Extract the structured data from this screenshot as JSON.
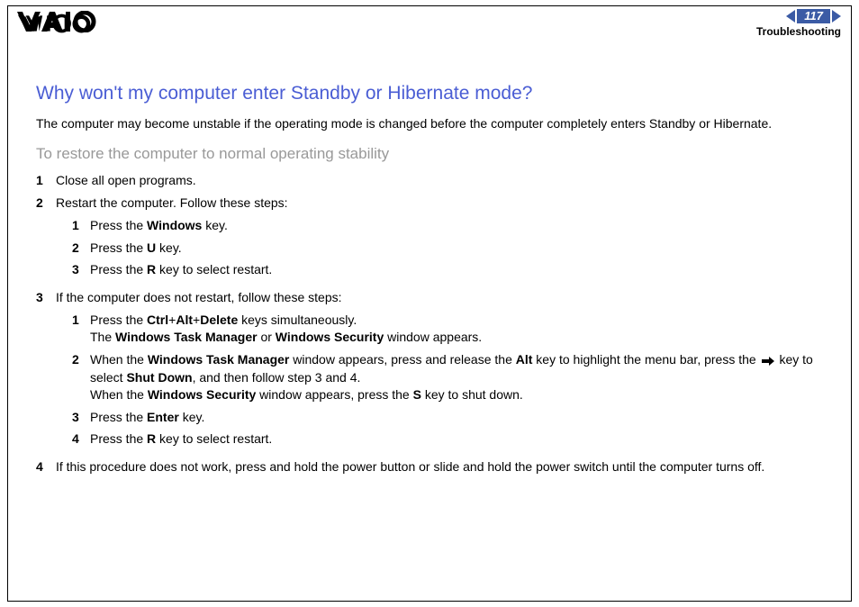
{
  "header": {
    "page_number": "117",
    "section": "Troubleshooting"
  },
  "title": "Why won't my computer enter Standby or Hibernate mode?",
  "intro": "The computer may become unstable if the operating mode is changed before the computer completely enters Standby or Hibernate.",
  "subtitle": "To restore the computer to normal operating stability",
  "steps": {
    "s1": {
      "num": "1",
      "text": "Close all open programs."
    },
    "s2": {
      "num": "2",
      "text": "Restart the computer. Follow these steps:",
      "sub": {
        "a": {
          "num": "1",
          "prefix": "Press the ",
          "key": "Windows",
          "suffix": " key."
        },
        "b": {
          "num": "2",
          "prefix": "Press the ",
          "key": "U",
          "suffix": " key."
        },
        "c": {
          "num": "3",
          "prefix": "Press the ",
          "key": "R",
          "suffix": " key to select restart."
        }
      }
    },
    "s3": {
      "num": "3",
      "text": "If the computer does not restart, follow these steps:",
      "sub": {
        "a": {
          "num": "1",
          "line1_prefix": "Press the ",
          "k1": "Ctrl",
          "plus1": "+",
          "k2": "Alt",
          "plus2": "+",
          "k3": "Delete",
          "line1_suffix": " keys simultaneously.",
          "line2_prefix": "The ",
          "wtm": "Windows Task Manager",
          "or": " or ",
          "ws": "Windows Security",
          "line2_suffix": " window appears."
        },
        "b": {
          "num": "2",
          "p1": "When the ",
          "wtm": "Windows Task Manager",
          "p2": " window appears, press and release the ",
          "alt": "Alt",
          "p3": " key to highlight the menu bar, press the ",
          "p4": " key to select ",
          "sd": "Shut Down",
          "p5": ", and then follow step 3 and 4.",
          "p6": "When the ",
          "ws": "Windows Security",
          "p7": " window appears, press the ",
          "s": "S",
          "p8": " key to shut down."
        },
        "c": {
          "num": "3",
          "prefix": "Press the ",
          "key": "Enter",
          "suffix": " key."
        },
        "d": {
          "num": "4",
          "prefix": "Press the ",
          "key": "R",
          "suffix": " key to select restart."
        }
      }
    },
    "s4": {
      "num": "4",
      "text": "If this procedure does not work, press and hold the power button or slide and hold the power switch until the computer turns off."
    }
  }
}
